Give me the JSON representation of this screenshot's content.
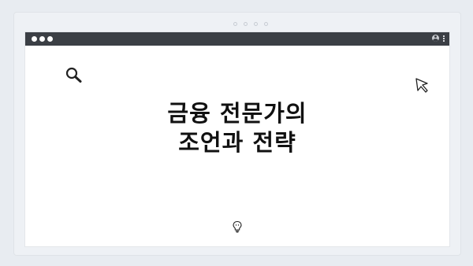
{
  "window": {
    "headline_line1": "금융 전문가의",
    "headline_line2": "조언과 전략"
  },
  "icons": {
    "search": "search-icon",
    "cursor": "cursor-icon",
    "lightbulb": "lightbulb-icon",
    "user": "user-icon",
    "menu": "kebab-menu-icon"
  },
  "colors": {
    "titlebar": "#3b3f45",
    "background": "#e8ecf1",
    "window": "#ffffff",
    "text": "#111111"
  }
}
